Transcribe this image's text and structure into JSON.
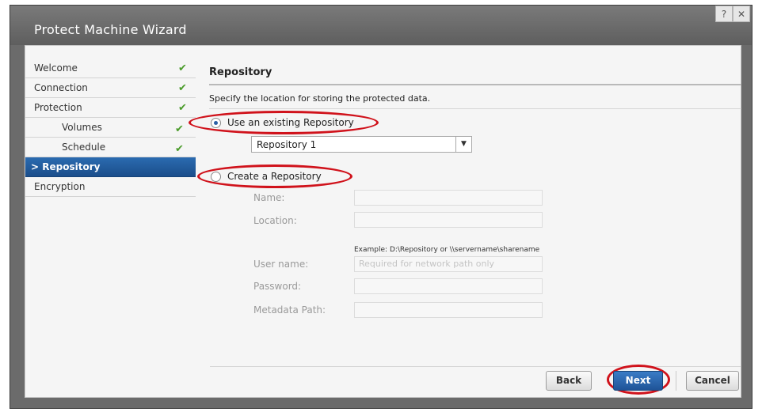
{
  "window": {
    "title": "Protect Machine Wizard",
    "help_glyph": "?",
    "close_glyph": "✕"
  },
  "nav": {
    "items": [
      {
        "label": "Welcome",
        "status": "done"
      },
      {
        "label": "Connection",
        "status": "done"
      },
      {
        "label": "Protection",
        "status": "done"
      },
      {
        "label": "Volumes",
        "status": "done"
      },
      {
        "label": "Schedule",
        "status": "done"
      },
      {
        "label": "Repository",
        "status": "active",
        "prefix": ">"
      },
      {
        "label": "Encryption",
        "status": "pending"
      }
    ],
    "check_glyph": "✔"
  },
  "content": {
    "section_title": "Repository",
    "description": "Specify the location for storing the protected data.",
    "option_existing": {
      "label": "Use an existing Repository",
      "selected": true
    },
    "repository_select": {
      "value": "Repository 1"
    },
    "option_create": {
      "label": "Create a Repository",
      "selected": false
    },
    "fields": {
      "name_label": "Name:",
      "location_label": "Location:",
      "example_text": "Example: D:\\Repository or \\\\servername\\sharename",
      "username_label": "User name:",
      "username_placeholder": "Required for network path only",
      "password_label": "Password:",
      "metadata_label": "Metadata Path:"
    }
  },
  "footer": {
    "back_label": "Back",
    "next_label": "Next",
    "cancel_label": "Cancel"
  },
  "colors": {
    "accent": "#1f5498",
    "highlight": "#d0121b",
    "check": "#4a9b2a"
  }
}
